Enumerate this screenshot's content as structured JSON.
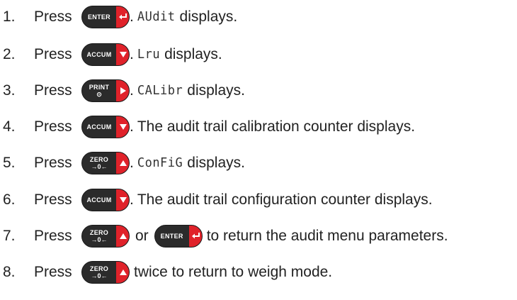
{
  "steps": [
    {
      "number": "1.",
      "press": "Press",
      "key": {
        "label": "ENTER",
        "sub": "",
        "icon": "enter-icon"
      },
      "display_code": "AUdit",
      "after": "displays."
    },
    {
      "number": "2.",
      "press": "Press",
      "key": {
        "label": "ACCUM",
        "sub": "",
        "icon": "down-arrow-icon"
      },
      "display_code": "Lru",
      "after": "displays."
    },
    {
      "number": "3.",
      "press": "Press",
      "key": {
        "label": "PRINT",
        "sub": "⊙",
        "icon": "right-arrow-icon"
      },
      "display_code": "CALibr",
      "after": "displays."
    },
    {
      "number": "4.",
      "press": "Press",
      "key": {
        "label": "ACCUM",
        "sub": "",
        "icon": "down-arrow-icon"
      },
      "after": "The audit trail calibration counter displays."
    },
    {
      "number": "5.",
      "press": "Press",
      "key": {
        "label": "ZERO",
        "sub": "→0←",
        "icon": "up-arrow-icon"
      },
      "display_code": "ConFiG",
      "after": "displays."
    },
    {
      "number": "6.",
      "press": "Press",
      "key": {
        "label": "ACCUM",
        "sub": "",
        "icon": "down-arrow-icon"
      },
      "after": "The audit trail configuration counter displays."
    },
    {
      "number": "7.",
      "press": "Press",
      "key": {
        "label": "ZERO",
        "sub": "→0←",
        "icon": "up-arrow-icon"
      },
      "or": "or",
      "key2": {
        "label": "ENTER",
        "sub": "",
        "icon": "enter-icon"
      },
      "after": "to return the audit menu parameters."
    },
    {
      "number": "8.",
      "press": "Press",
      "key": {
        "label": "ZERO",
        "sub": "→0←",
        "icon": "up-arrow-icon"
      },
      "after": "twice to return to weigh mode."
    }
  ],
  "colors": {
    "key_body": "#2b2b2b",
    "key_accent": "#e0222a",
    "text": "#222222"
  }
}
